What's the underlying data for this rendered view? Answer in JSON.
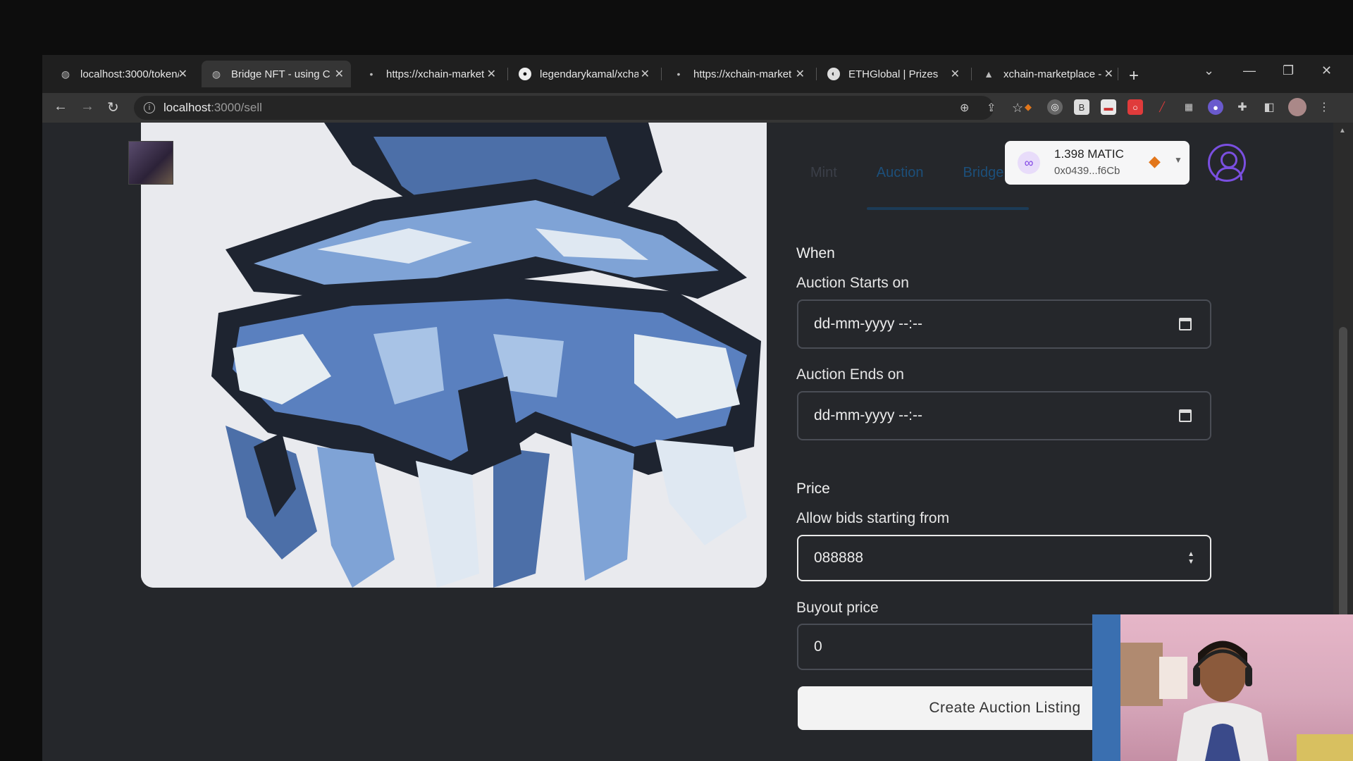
{
  "browser": {
    "tabs": [
      {
        "title": "localhost:3000/token/",
        "icon": "globe-icon",
        "active": false
      },
      {
        "title": "Bridge NFT - using Co",
        "icon": "globe-icon",
        "active": true
      },
      {
        "title": "https://xchain-market",
        "icon": "dot-icon",
        "active": false
      },
      {
        "title": "legendarykamal/xchai",
        "icon": "github-icon",
        "active": false
      },
      {
        "title": "https://xchain-market",
        "icon": "dot-icon",
        "active": false
      },
      {
        "title": "ETHGlobal | Prizes",
        "icon": "ethglobal-icon",
        "active": false
      },
      {
        "title": "xchain-marketplace -",
        "icon": "vercel-icon",
        "active": false
      }
    ],
    "url_host": "localhost",
    "url_path": ":3000/sell"
  },
  "header": {
    "nav_tabs": [
      "Mint",
      "Auction",
      "Bridge"
    ],
    "wallet": {
      "balance": "1.398 MATIC",
      "address": "0x0439...f6Cb"
    }
  },
  "form": {
    "when_heading": "When",
    "starts_label": "Auction Starts on",
    "starts_value": "dd-mm-yyyy --:--",
    "ends_label": "Auction Ends on",
    "ends_value": "dd-mm-yyyy --:--",
    "price_heading": "Price",
    "bids_label": "Allow bids starting from",
    "bids_value": "088888",
    "buyout_label": "Buyout price",
    "buyout_value": "0",
    "create_button": "Create Auction Listing"
  }
}
